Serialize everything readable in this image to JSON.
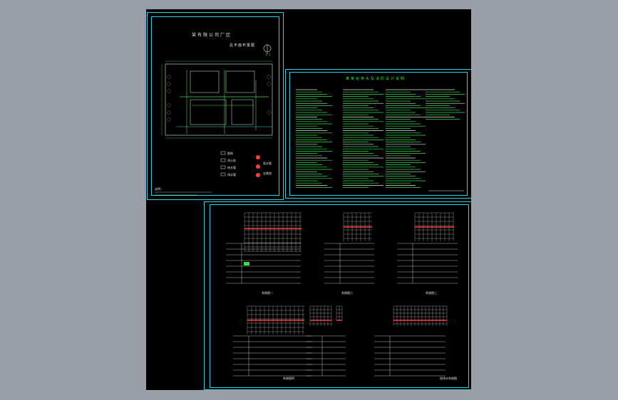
{
  "sheets": {
    "site_plan": {
      "title": "某有限公司厂区",
      "subtitle": "总平面布置图",
      "scale": "1:1",
      "legend_items": [
        "图例",
        "消火栓",
        "给水管",
        "排水管",
        "雨水管",
        "化粪池"
      ],
      "note_label": "说明:"
    },
    "table_sheet": {
      "title": "某某给排水及消防设计说明"
    },
    "detail_sheet": {
      "caption_a": "系统图一",
      "caption_b": "系统图二",
      "caption_c": "系统图三",
      "caption_d": "系统图四",
      "footer": "给排水系统图"
    }
  },
  "colors": {
    "background": "#9a9fa7",
    "canvas": "#000000",
    "frame": "#2ad3e6",
    "line": "#e6e6e6",
    "green": "#39e04a",
    "red": "#ff4040"
  }
}
